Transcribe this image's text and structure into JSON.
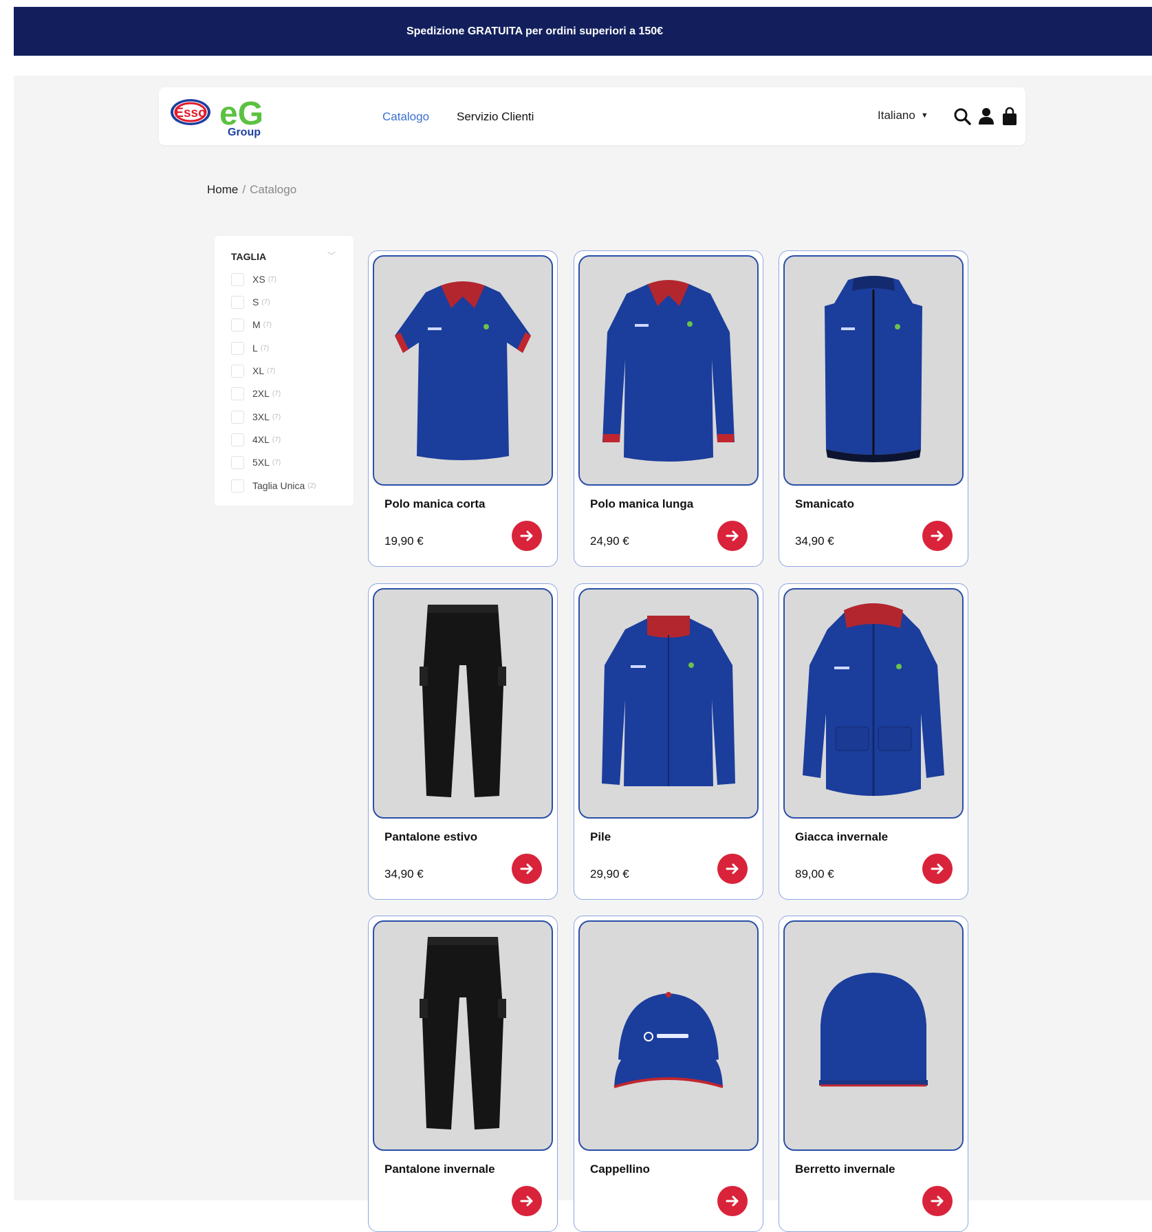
{
  "announcement": "Spedizione GRATUITA per ordini superiori a 150€",
  "logo": {
    "esso": "Esso",
    "eg": "eG",
    "group": "Group"
  },
  "nav": {
    "catalog": "Catalogo",
    "customer_service": "Servizio Clienti"
  },
  "language": "Italiano",
  "breadcrumb": {
    "home": "Home",
    "separator": "/",
    "current": "Catalogo"
  },
  "filter": {
    "title": "TAGLIA",
    "options": [
      {
        "label": "XS",
        "count": "(7)"
      },
      {
        "label": "S",
        "count": "(7)"
      },
      {
        "label": "M",
        "count": "(7)"
      },
      {
        "label": "L",
        "count": "(7)"
      },
      {
        "label": "XL",
        "count": "(7)"
      },
      {
        "label": "2XL",
        "count": "(7)"
      },
      {
        "label": "3XL",
        "count": "(7)"
      },
      {
        "label": "4XL",
        "count": "(7)"
      },
      {
        "label": "5XL",
        "count": "(7)"
      },
      {
        "label": "Taglia Unica",
        "count": "(2)"
      }
    ]
  },
  "products": [
    {
      "name": "Polo manica corta",
      "price": "19,90 €"
    },
    {
      "name": "Polo manica lunga",
      "price": "24,90 €"
    },
    {
      "name": "Smanicato",
      "price": "34,90 €"
    },
    {
      "name": "Pantalone estivo",
      "price": "34,90 €"
    },
    {
      "name": "Pile",
      "price": "29,90 €"
    },
    {
      "name": "Giacca invernale",
      "price": "89,00 €"
    },
    {
      "name": "Pantalone invernale",
      "price": ""
    },
    {
      "name": "Cappellino",
      "price": ""
    },
    {
      "name": "Berretto invernale",
      "price": ""
    }
  ],
  "colors": {
    "navy": "#121f5c",
    "accent_blue": "#3a6fd2",
    "cta_red": "#d9233a",
    "garment_blue": "#1b3d9c"
  }
}
